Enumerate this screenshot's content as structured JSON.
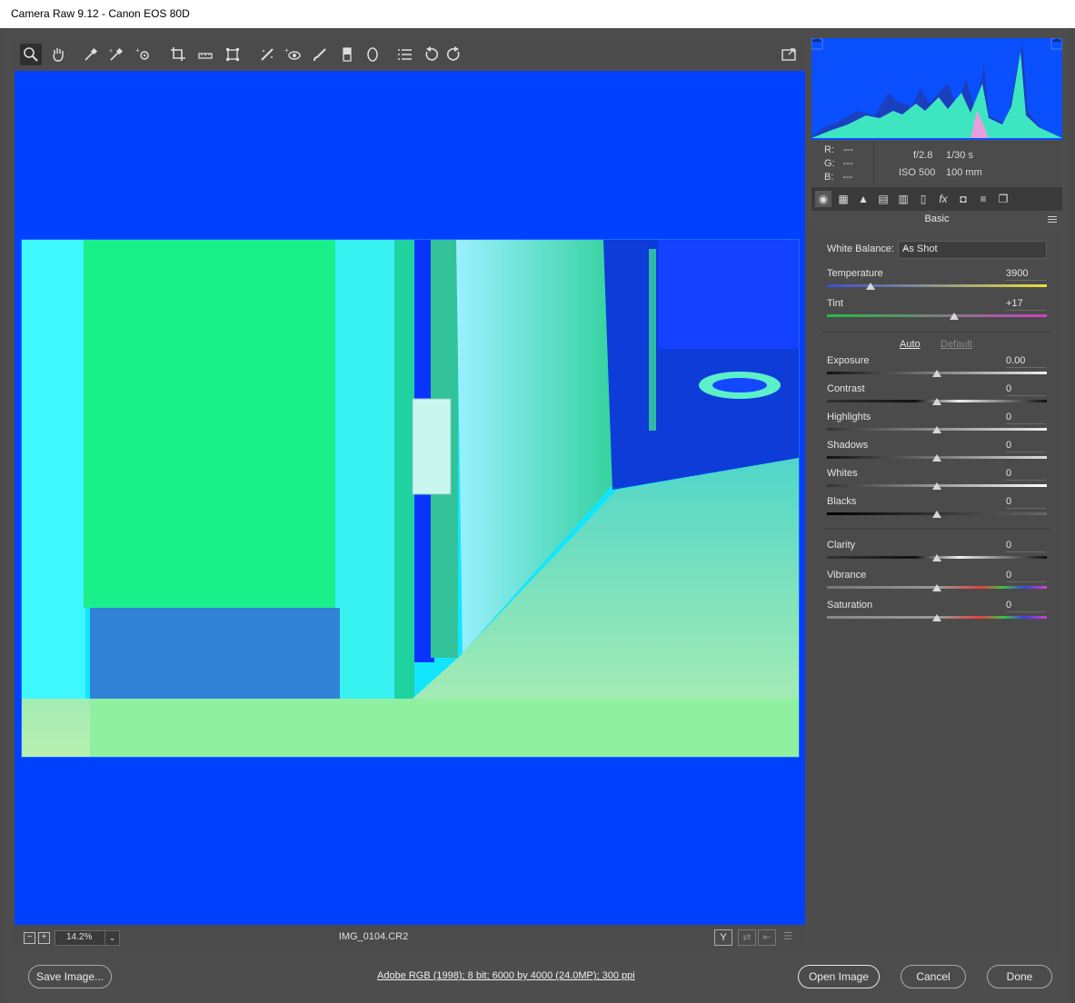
{
  "window": {
    "title": "Camera Raw 9.12  -  Canon EOS 80D"
  },
  "toolbar": {
    "tools": [
      {
        "name": "zoom-icon"
      },
      {
        "name": "hand-icon"
      },
      {
        "name": "white-balance-icon"
      },
      {
        "name": "color-sampler-icon"
      },
      {
        "name": "targeted-adjustment-icon"
      },
      {
        "name": "crop-icon"
      },
      {
        "name": "straighten-icon"
      },
      {
        "name": "transform-icon"
      },
      {
        "name": "spot-removal-icon"
      },
      {
        "name": "red-eye-icon"
      },
      {
        "name": "adjustment-brush-icon"
      },
      {
        "name": "graduated-filter-icon"
      },
      {
        "name": "radial-filter-icon"
      },
      {
        "name": "presets-icon"
      },
      {
        "name": "rotate-left-icon"
      },
      {
        "name": "rotate-right-icon"
      }
    ],
    "fullscreen_icon": "fullscreen-icon"
  },
  "canvas": {
    "zoom_minus": "−",
    "zoom_plus": "+",
    "zoom_value": "14.2%",
    "filename": "IMG_0104.CR2",
    "y_label": "Y"
  },
  "info": {
    "r_label": "R:",
    "r_value": "---",
    "g_label": "G:",
    "g_value": "---",
    "b_label": "B:",
    "b_value": "---",
    "aperture": "f/2.8",
    "shutter": "1/30 s",
    "iso": "ISO 500",
    "focal": "100 mm"
  },
  "panel": {
    "title": "Basic",
    "white_balance_label": "White Balance:",
    "white_balance_value": "As Shot",
    "auto_label": "Auto",
    "default_label": "Default",
    "sliders": [
      {
        "label": "Temperature",
        "value": "3900",
        "level": 0.2
      },
      {
        "label": "Tint",
        "value": "+17",
        "level": 0.58
      },
      {
        "label": "Exposure",
        "value": "0.00",
        "level": 0.5
      },
      {
        "label": "Contrast",
        "value": "0",
        "level": 0.5
      },
      {
        "label": "Highlights",
        "value": "0",
        "level": 0.5
      },
      {
        "label": "Shadows",
        "value": "0",
        "level": 0.5
      },
      {
        "label": "Whites",
        "value": "0",
        "level": 0.5
      },
      {
        "label": "Blacks",
        "value": "0",
        "level": 0.5
      },
      {
        "label": "Clarity",
        "value": "0",
        "level": 0.5
      },
      {
        "label": "Vibrance",
        "value": "0",
        "level": 0.5
      },
      {
        "label": "Saturation",
        "value": "0",
        "level": 0.5
      }
    ]
  },
  "footer": {
    "save_label": "Save Image...",
    "color_info": "Adobe RGB (1998); 8 bit; 6000 by 4000 (24.0MP); 300 ppi",
    "open_label": "Open Image",
    "cancel_label": "Cancel",
    "done_label": "Done"
  },
  "colors": {
    "canvas_bg": "#0040ff",
    "panel_bg": "#4b4b4b"
  }
}
